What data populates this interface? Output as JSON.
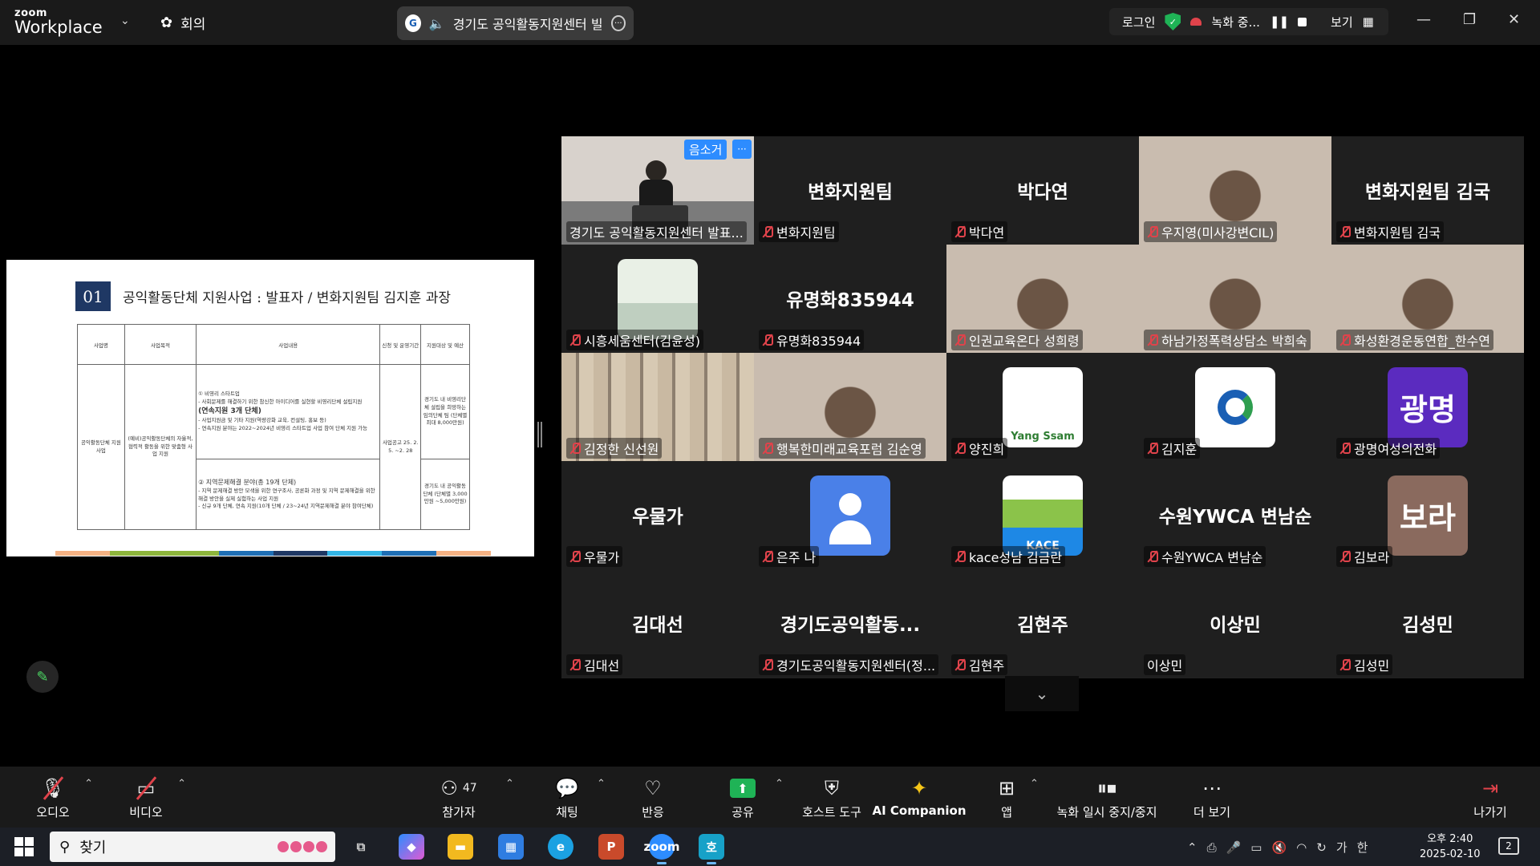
{
  "app": {
    "brand_top": "zoom",
    "brand_bottom": "Workplace",
    "meeting_menu_label": "회의"
  },
  "title_pill": {
    "text": "경기도 공익활동지원센터 빌"
  },
  "status_bar": {
    "login": "로그인",
    "recording": "녹화 중...",
    "view": "보기"
  },
  "shared_slide": {
    "number": "01",
    "title": "공익활동단체 지원사업 : 발표자 / 변화지원팀 김지훈 과장",
    "table_headers": [
      "사업명",
      "사업목적",
      "사업내용",
      "신청 및 운영기간",
      "지원대상 및 예산"
    ],
    "row_name": "공익활동단체 지원사업",
    "row_purpose": "(예비)공익활동단체의 자율적, 협력적 활동을 위한 맞춤형 사업 지원",
    "content_top": [
      "① 비영리 스타트업",
      "- 사회문제를 해결하기 위한 참신한 아이디어를 실현할 비영리단체 설립지원",
      "(연속지원 3개 단체)",
      "- 사업지원금 및 기타 지원(역량강화 교육, 컨설팅, 홍보 등)",
      "- 연속지원 분야는 2022~2024년 비영리 스타트업 사업 참여 단체 지원 가능"
    ],
    "content_bottom": [
      "② 지역문제해결 분야(총 19개 단체)",
      "- 지역 문제해결 방안 모색을 위한 연구조사, 공론화 과정 및 지역 문제해결을 위한",
      "해결 방안을 실제 실험하는 사업 지원",
      "- 신규 9개 단체, 연속 지원(10개 단체 / 23~24년 지역문제해결 분야 참여단체)"
    ],
    "period": "사업공고 25. 2. 5. ~2. 28",
    "target_top": "경기도 내 비영리단체 설립을 희망하는 임의단체 팀 (단체별 최대 8,000만원)",
    "target_bottom": "경기도 내 공익활동단체 (단체별 3,000만원 ~5,000만원)",
    "bar_colors": [
      "#f4b183",
      "#8db53c",
      "#8db53c",
      "#1f6fb5",
      "#1f3864",
      "#33b5e5",
      "#1f6fb5",
      "#f4b183"
    ]
  },
  "gallery": {
    "speaker_badge": "음소거",
    "participants": [
      {
        "label": "경기도 공익활동지원센터 발표...",
        "muted": false,
        "kind": "video-speaker"
      },
      {
        "label": "변화지원팀",
        "big": "변화지원팀",
        "muted": true,
        "kind": "name"
      },
      {
        "label": "박다연",
        "big": "박다연",
        "muted": true,
        "kind": "name"
      },
      {
        "label": "우지영(미사강변CIL)",
        "muted": true,
        "kind": "video"
      },
      {
        "label": "변화지원팀 김국",
        "big": "변화지원팀 김국",
        "muted": true,
        "kind": "name"
      },
      {
        "label": "시흥세움센터(김윤성)",
        "muted": true,
        "kind": "avatar-room"
      },
      {
        "label": "유명화835944",
        "big": "유명화835944",
        "muted": true,
        "kind": "name"
      },
      {
        "label": "인권교육온다 성희령",
        "muted": true,
        "kind": "video"
      },
      {
        "label": "하남가정폭력상담소 박희숙",
        "muted": true,
        "kind": "video"
      },
      {
        "label": "화성환경운동연합_한수연",
        "muted": true,
        "kind": "video"
      },
      {
        "label": "김정한 신선원",
        "muted": true,
        "kind": "video-shelf"
      },
      {
        "label": "행복한미래교육포럼 김순영",
        "muted": true,
        "kind": "video"
      },
      {
        "label": "양진희",
        "muted": true,
        "kind": "avatar-logo",
        "avatar_text": "Yang Ssam"
      },
      {
        "label": "김지훈",
        "muted": true,
        "kind": "avatar-center"
      },
      {
        "label": "광명여성의전화",
        "muted": true,
        "kind": "avatar-text",
        "avatar_text": "광명",
        "avatar_color": "#5b2bbf"
      },
      {
        "label": "우물가",
        "big": "우물가",
        "muted": true,
        "kind": "name"
      },
      {
        "label": "은주 나",
        "muted": true,
        "kind": "avatar-person"
      },
      {
        "label": "kace성남 김금란",
        "muted": true,
        "kind": "avatar-kace",
        "avatar_text": "KACE"
      },
      {
        "label": "수원YWCA 변남순",
        "big": "수원YWCA 변남순",
        "muted": true,
        "kind": "name"
      },
      {
        "label": "김보라",
        "muted": true,
        "kind": "avatar-text",
        "avatar_text": "보라",
        "avatar_color": "#8a6a5e"
      },
      {
        "label": "김대선",
        "big": "김대선",
        "muted": true,
        "kind": "name"
      },
      {
        "label": "경기도공익활동지원센터(정...",
        "big": "경기도공익활동...",
        "muted": true,
        "kind": "name"
      },
      {
        "label": "김현주",
        "big": "김현주",
        "muted": true,
        "kind": "name"
      },
      {
        "label": "이상민",
        "big": "이상민",
        "muted": false,
        "kind": "name"
      },
      {
        "label": "김성민",
        "big": "김성민",
        "muted": true,
        "kind": "name"
      }
    ]
  },
  "toolbar": {
    "audio": "오디오",
    "video": "비디오",
    "participants": "참가자",
    "participants_count": "47",
    "chat": "채팅",
    "react": "반응",
    "share": "공유",
    "host_tools": "호스트 도구",
    "ai_companion": "AI Companion",
    "apps": "앱",
    "recording": "녹화 일시 중지/중지",
    "more": "더 보기",
    "leave": "나가기"
  },
  "taskbar": {
    "search_placeholder": "찾기",
    "clock_time": "오후 2:40",
    "clock_date": "2025-02-10",
    "ime_1": "가",
    "ime_2": "한",
    "notifications": "2"
  }
}
